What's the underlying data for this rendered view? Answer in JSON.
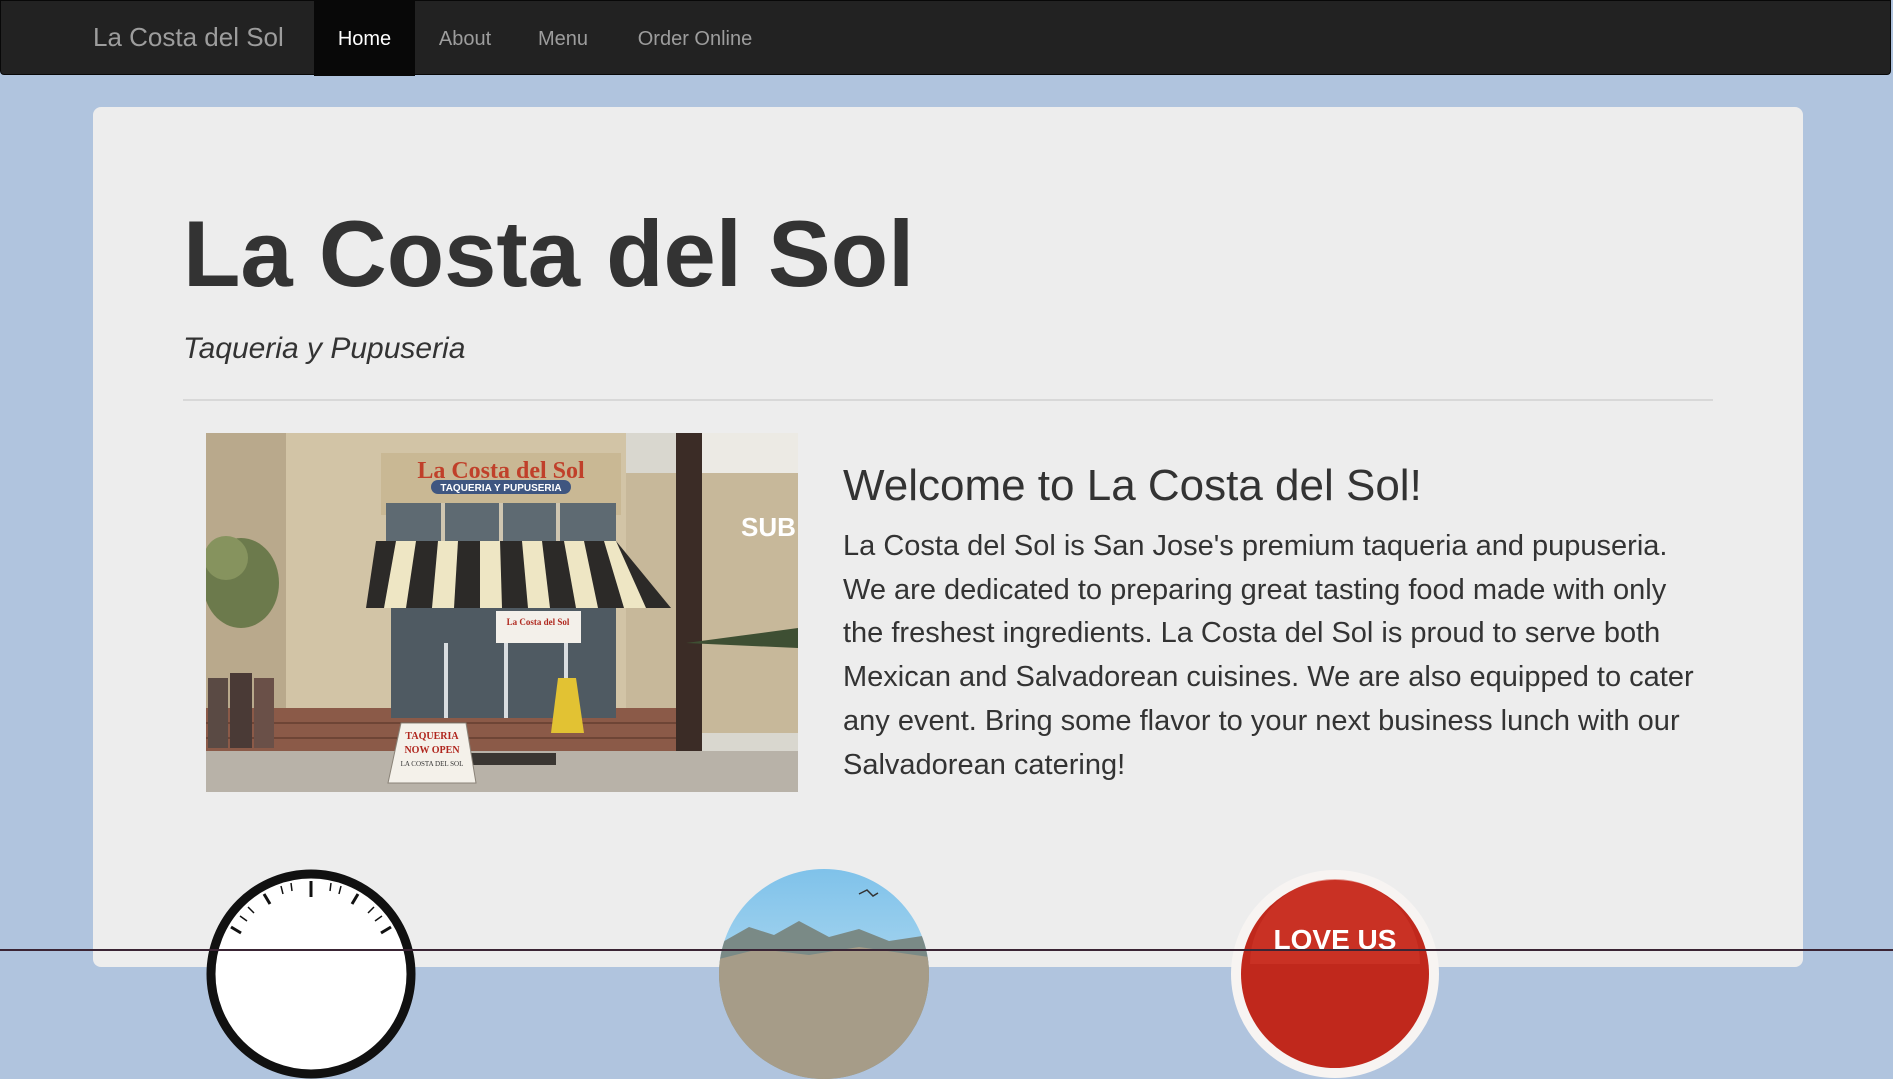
{
  "navbar": {
    "brand": "La Costa del Sol",
    "items": [
      {
        "label": "Home",
        "active": true
      },
      {
        "label": "About",
        "active": false
      },
      {
        "label": "Menu",
        "active": false
      },
      {
        "label": "Order Online",
        "active": false
      }
    ]
  },
  "hero": {
    "title": "La Costa del Sol",
    "subtitle": "Taqueria y Pupuseria"
  },
  "storefront": {
    "sign": "La Costa del Sol",
    "banner": "TAQUERIA Y PUPUSERIA",
    "door_sign": "La Costa del Sol",
    "sandwich_board_lines": [
      "TAQUERIA",
      "NOW OPEN",
      "LA COSTA DEL SOL"
    ],
    "neighbor_sign": "SUB"
  },
  "welcome": {
    "title": "Welcome to La Costa del Sol!",
    "body": "La Costa del Sol is San Jose's premium taqueria and pupuseria. We are dedicated to preparing great tasting food made with only the freshest ingredients. La Costa del Sol is proud to serve both Mexican and Salvadorean cuisines. We are also equipped to cater any event. Bring some flavor to your next business lunch with our Salvadorean catering!"
  },
  "features": [
    {
      "icon": "clock-icon"
    },
    {
      "icon": "location-photo-icon"
    },
    {
      "icon": "love-us-badge-icon",
      "label": "LOVE US"
    }
  ],
  "colors": {
    "page_background": "#b0c4de",
    "navbar_background": "#222222",
    "navbar_active": "#080808",
    "jumbotron_background": "#ededed",
    "text": "#333333",
    "badge_red": "#c0281c"
  }
}
